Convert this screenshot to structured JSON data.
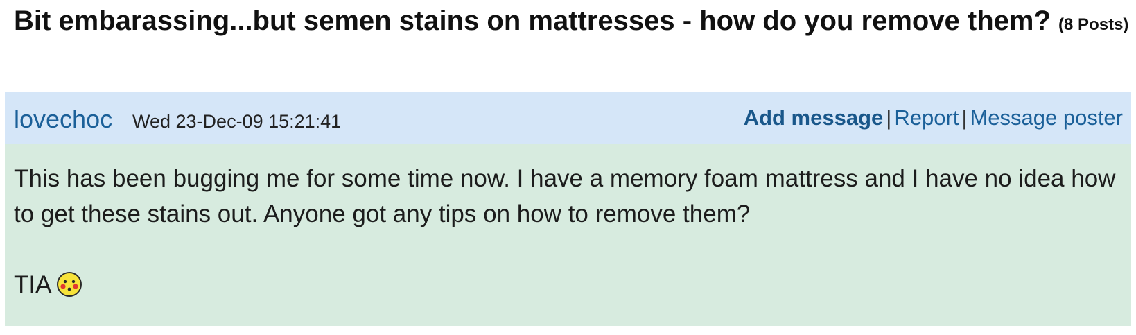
{
  "thread": {
    "title": "Bit embarassing...but semen stains on mattresses - how do you remove them?",
    "post_count": "(8 Posts)"
  },
  "post": {
    "poster": "lovechoc",
    "date": "Wed 23-Dec-09 15:21:41",
    "actions": {
      "add_message": "Add message",
      "separator": "|",
      "report": "Report",
      "message_poster": "Message poster"
    },
    "body": {
      "paragraph_1": "This has been bugging me for some time now. I have a memory foam mattress and I have no idea how to get these stains out. Anyone got any tips on how to remove them?",
      "paragraph_2": "TIA",
      "emoticon": "blushing-smiley-icon"
    },
    "colors": {
      "header_bg": "#d5e6f8",
      "body_bg": "#d7ebdf",
      "link": "#1b6099"
    }
  }
}
